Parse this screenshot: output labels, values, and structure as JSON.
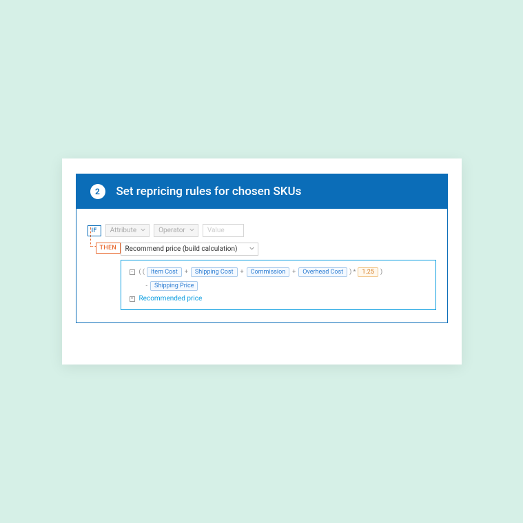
{
  "header": {
    "step_number": "2",
    "title": "Set repricing rules for chosen SKUs"
  },
  "rule": {
    "if_label": "IF",
    "then_label": "THEN",
    "attribute_placeholder": "Attribute",
    "operator_placeholder": "Operator",
    "value_placeholder": "Value",
    "action_label": "Recommend price (build calculation)"
  },
  "calc": {
    "open1": "( (",
    "chip1": "Item Cost",
    "plus": "+",
    "chip2": "Shipping Cost",
    "chip3": "Commission",
    "chip4": "Overhead Cost",
    "close_mult": ") *",
    "multiplier": "1.25",
    "close2": ")",
    "minus": "-",
    "chip5": "Shipping Price",
    "result_label": "Recommended price"
  }
}
